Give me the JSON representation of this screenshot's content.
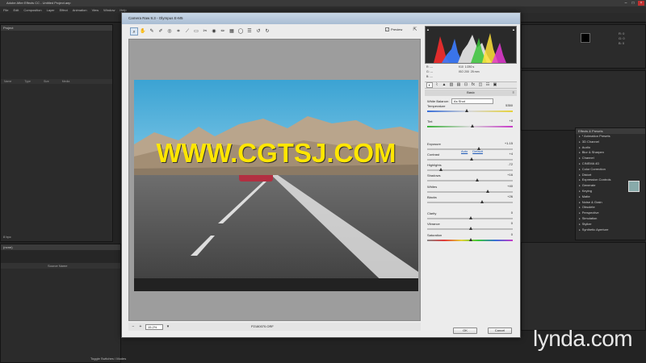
{
  "ae": {
    "window_title": "Adobe After Effects CC - Untitled Project.aep",
    "menu": [
      "File",
      "Edit",
      "Composition",
      "Layer",
      "Effect",
      "Animation",
      "View",
      "Window",
      "Help"
    ],
    "project_panel": {
      "title": "Project",
      "columns": [
        "Name",
        "Type",
        "Size",
        "Media"
      ],
      "bpc": "8 bpc"
    },
    "info_panel": {
      "line1": "R: 0",
      "line2": "G: 0",
      "line3": "B: 0"
    },
    "effects_title": "Effects & Presets",
    "effects": [
      "* Animation Presets",
      "3D Channel",
      "Audio",
      "Blur & Sharpen",
      "Channel",
      "CINEMA 4D",
      "Color Correction",
      "Distort",
      "Expression Controls",
      "Generate",
      "Keying",
      "Matte",
      "Noise & Grain",
      "Obsolete",
      "Perspective",
      "Simulation",
      "Stylize",
      "Synthetic Aperture"
    ],
    "timeline": {
      "tab": "(none)",
      "layer_col": "Source Name",
      "footer": "Toggle Switches / Modes"
    }
  },
  "camera_raw": {
    "title": "Camera Raw 8.3  -  Olympus E-M5",
    "preview_label": "Preview",
    "preview_checked": true,
    "zoom": "15.2%",
    "filename": "P2180070.ORF",
    "readout": {
      "r": "R:",
      "g": "G:",
      "b": "B:",
      "r_val": "---",
      "g_val": "---",
      "b_val": "---",
      "aperture": "f/10",
      "shutter": "1/250 s",
      "iso": "ISO 200",
      "focal": "25 mm"
    },
    "panel_title": "Basic",
    "white_balance": {
      "label": "White Balance:",
      "value": "As Shot"
    },
    "auto_label": "Auto",
    "default_label": "Default",
    "sliders": [
      {
        "label": "Temperature",
        "value": "5350",
        "pos": 0.45,
        "track": "temp"
      },
      {
        "label": "Tint",
        "value": "+8",
        "pos": 0.52,
        "track": "tint"
      },
      {
        "label": "Exposure",
        "value": "+1.15",
        "pos": 0.6,
        "track": "gray"
      },
      {
        "label": "Contrast",
        "value": "+4",
        "pos": 0.51,
        "track": "gray"
      },
      {
        "label": "Highlights",
        "value": "-72",
        "pos": 0.14,
        "track": "gray"
      },
      {
        "label": "Shadows",
        "value": "+16",
        "pos": 0.58,
        "track": "gray"
      },
      {
        "label": "Whites",
        "value": "+40",
        "pos": 0.7,
        "track": "gray"
      },
      {
        "label": "Blacks",
        "value": "+26",
        "pos": 0.63,
        "track": "gray"
      },
      {
        "label": "Clarity",
        "value": "0",
        "pos": 0.5,
        "track": "gray"
      },
      {
        "label": "Vibrance",
        "value": "0",
        "pos": 0.5,
        "track": "gray"
      },
      {
        "label": "Saturation",
        "value": "0",
        "pos": 0.5,
        "track": "sat"
      }
    ],
    "ok_label": "OK",
    "cancel_label": "Cancel"
  },
  "watermark": "WWW.CGTSJ.COM",
  "brand": "lynda.com",
  "colors": {
    "sky_top": "#3ba3d3",
    "watermark": "#ffe600",
    "dialog_title": "#b9cadd"
  }
}
